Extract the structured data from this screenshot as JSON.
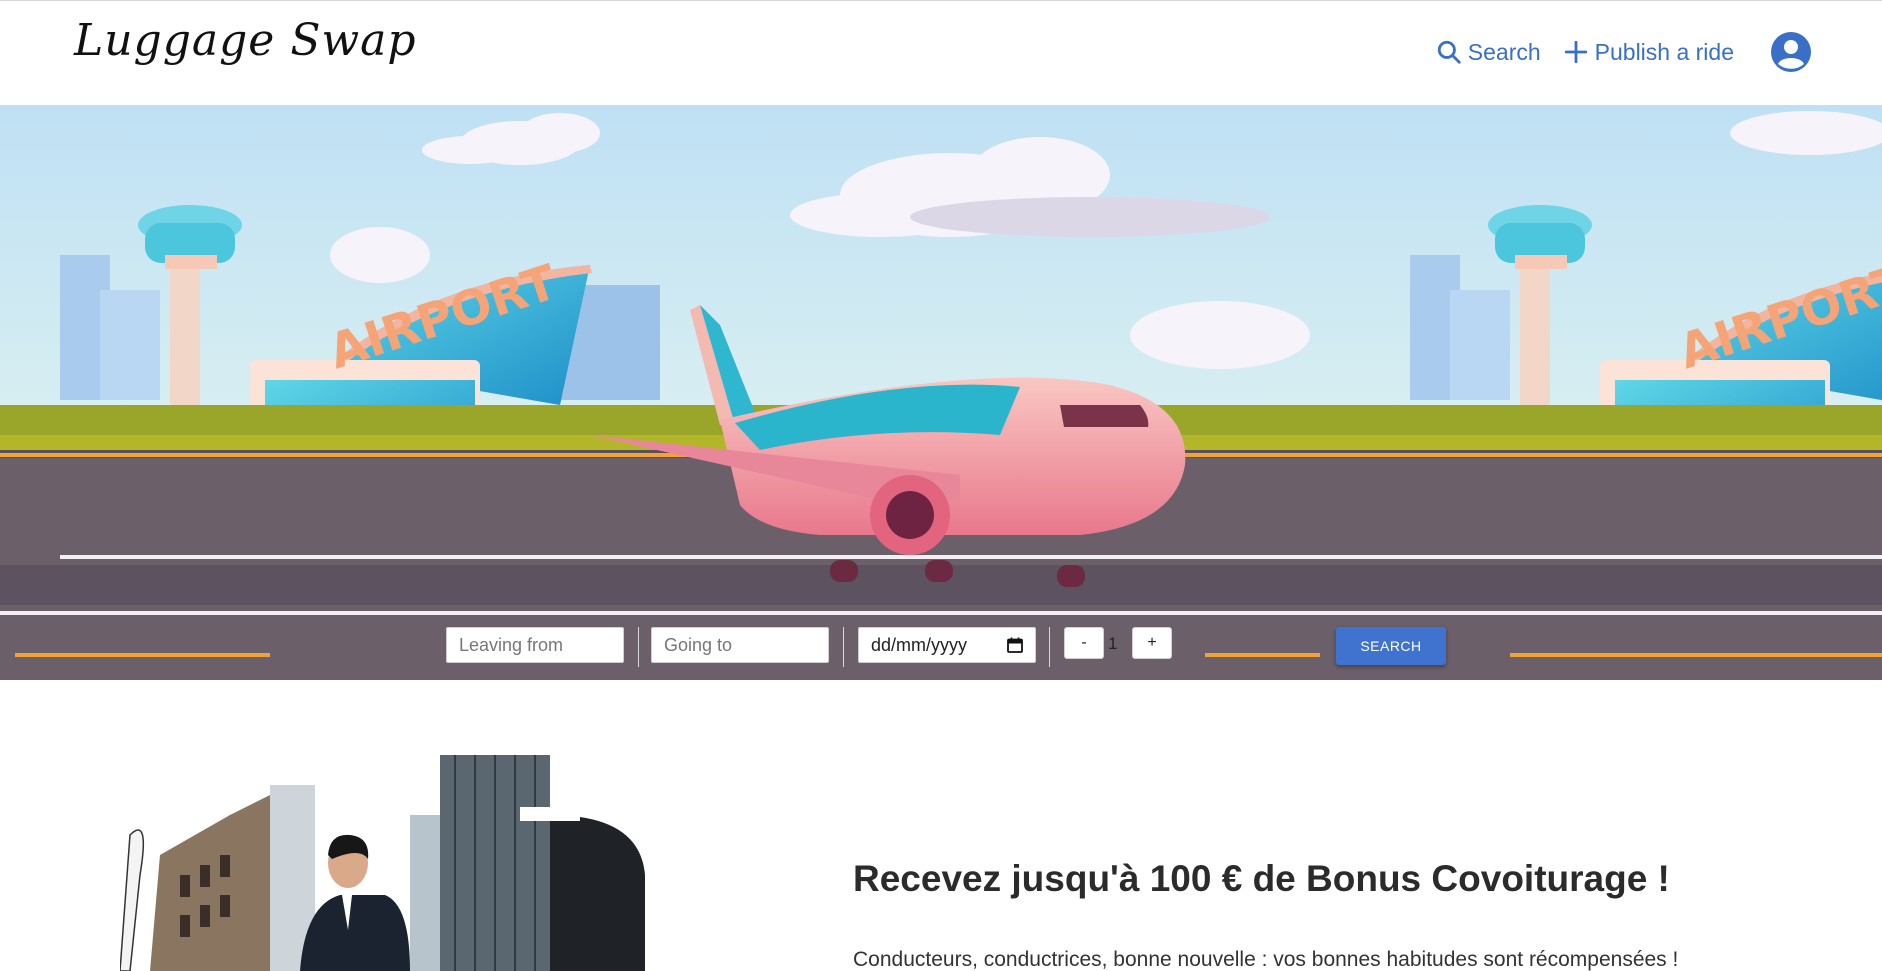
{
  "header": {
    "logo": "Luggage Swap",
    "nav": {
      "search_label": "Search",
      "publish_label": "Publish a ride",
      "search_icon": "search-icon",
      "publish_icon": "plus-icon",
      "avatar_icon": "user-circle-icon"
    },
    "accent_color": "#3a6fc8"
  },
  "hero": {
    "sign_text": "AIRPORT",
    "search_form": {
      "from_placeholder": "Leaving from",
      "to_placeholder": "Going to",
      "date_placeholder": "dd/mm/yyyy",
      "decrement_label": "-",
      "passengers": "1",
      "increment_label": "+",
      "submit_label": "SEARCH",
      "submit_color": "#3f73cf"
    }
  },
  "promo": {
    "title": "Recevez jusqu'à 100 € de Bonus Covoiturage !",
    "text": "Conducteurs, conductrices, bonne nouvelle : vos bonnes habitudes sont récompensées !"
  }
}
